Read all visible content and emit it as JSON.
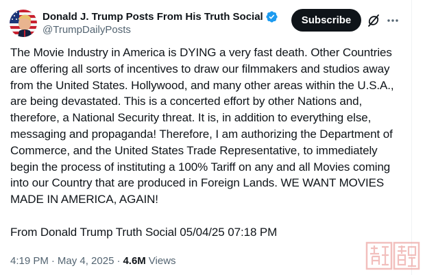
{
  "author": {
    "display_name": "Donald J. Trump Posts From His Truth Social",
    "handle": "@TrumpDailyPosts"
  },
  "header": {
    "subscribe_label": "Subscribe",
    "icons": [
      "verified-badge-icon",
      "grok-icon",
      "more-options-icon"
    ]
  },
  "tweet": {
    "text": "The Movie Industry in America is DYING a very fast death. Other Countries are offering all sorts of incentives to draw our filmmakers and studios away from the United States. Hollywood, and many other areas within the U.S.A., are being devastated. This is a concerted effort by other Nations and, therefore, a National Security threat. It is, in addition to everything else, messaging and propaganda! Therefore, I am authorizing the Department of Commerce, and the United States Trade Representative, to immediately begin the process of instituting a 100% Tariff on any and all Movies coming into our Country that are produced in Foreign Lands. WE WANT MOVIES MADE IN AMERICA, AGAIN!",
    "source_line": "From Donald Trump Truth Social 05/04/25 07:18 PM"
  },
  "meta": {
    "time": "4:19 PM",
    "separator": "·",
    "date": "May 4, 2025",
    "views_count": "4.6M",
    "views_label": "Views"
  },
  "colors": {
    "text_primary": "#0f1419",
    "text_secondary": "#536471",
    "verified_blue": "#1d9bf0",
    "button_dark": "#0f1419",
    "watermark_red": "#d9534f"
  }
}
